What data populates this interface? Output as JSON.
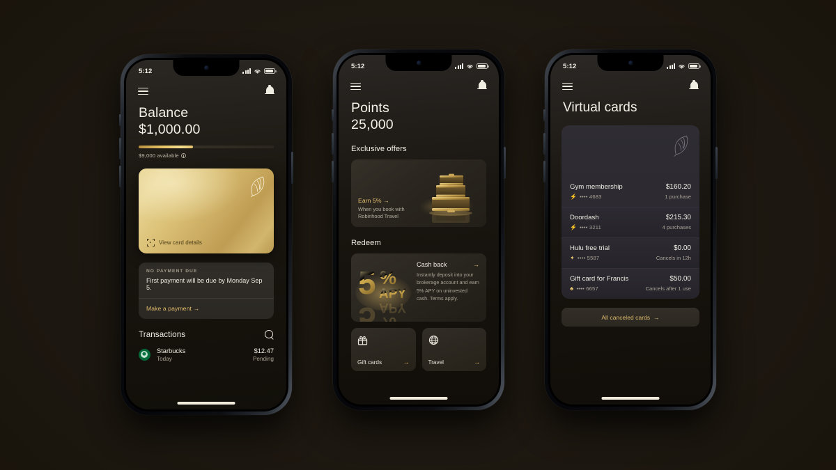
{
  "statusbar": {
    "time": "5:12",
    "signal_icon": "cellular-bars-icon",
    "wifi_icon": "wifi-icon",
    "battery_icon": "battery-icon"
  },
  "icons": {
    "menu": "hamburger-menu-icon",
    "bell": "notification-bell-icon",
    "search": "search-icon",
    "feather": "robinhood-feather-logo",
    "scan": "scan-card-icon",
    "gift": "gift-box-icon",
    "globe": "globe-icon",
    "arrow": "arrow-right-icon",
    "bolt": "lightning-bolt-icon",
    "info": "info-icon"
  },
  "colors": {
    "gold": "#e3c072",
    "gold_bright": "#f5dd8e",
    "cream": "#f0ede3",
    "muted": "#a8a294",
    "bg": "#1d1811",
    "card_dark": "#2a2730"
  },
  "phone1": {
    "title": "Balance",
    "value": "$1,000.00",
    "progress_percent": 40,
    "available": "$9,000 available",
    "card": {
      "view_details": "View card details"
    },
    "payment": {
      "kicker": "NO PAYMENT DUE",
      "text": "First payment will be due by Monday Sep 5.",
      "link": "Make a payment",
      "arrow": "→"
    },
    "transactions": {
      "heading": "Transactions",
      "items": [
        {
          "merchant": "Starbucks",
          "date": "Today",
          "amount": "$12.47",
          "status": "Pending",
          "logo": "starbucks-logo"
        }
      ]
    }
  },
  "phone2": {
    "title": "Points",
    "value": "25,000",
    "exclusive_offers": {
      "heading": "Exclusive offers",
      "offer": {
        "link": "Earn 5%",
        "arrow": "→",
        "line1": "When you book with",
        "line2": "Robinhood Travel",
        "art": "stacked-gold-suitcases"
      }
    },
    "redeem": {
      "heading": "Redeem",
      "cashback": {
        "art_number": "5",
        "art_percent": "%",
        "art_apy": "APY",
        "title": "Cash back",
        "arrow": "→",
        "description": "Instantly deposit into your brokerage account and earn 5% APY on uninvested cash. Terms apply."
      },
      "tiles": [
        {
          "label": "Gift cards",
          "icon": "gift-box-icon",
          "arrow": "→"
        },
        {
          "label": "Travel",
          "icon": "globe-icon",
          "arrow": "→"
        }
      ]
    }
  },
  "phone3": {
    "title": "Virtual cards",
    "cards": [
      {
        "name": "Gym membership",
        "amount": "$160.20",
        "mask": "•••• 4683",
        "meta": "1 purchase",
        "icon": "⚡"
      },
      {
        "name": "Doordash",
        "amount": "$215.30",
        "mask": "•••• 3211",
        "meta": "4 purchases",
        "icon": "⚡"
      },
      {
        "name": "Hulu free trial",
        "amount": "$0.00",
        "mask": "•••• 5587",
        "meta": "Cancels in 12h",
        "icon": "✦"
      },
      {
        "name": "Gift card for Francis",
        "amount": "$50.00",
        "mask": "•••• 6657",
        "meta": "Cancels after 1 use",
        "icon": "♣"
      }
    ],
    "all_canceled": {
      "label": "All canceled cards",
      "arrow": "→"
    }
  }
}
